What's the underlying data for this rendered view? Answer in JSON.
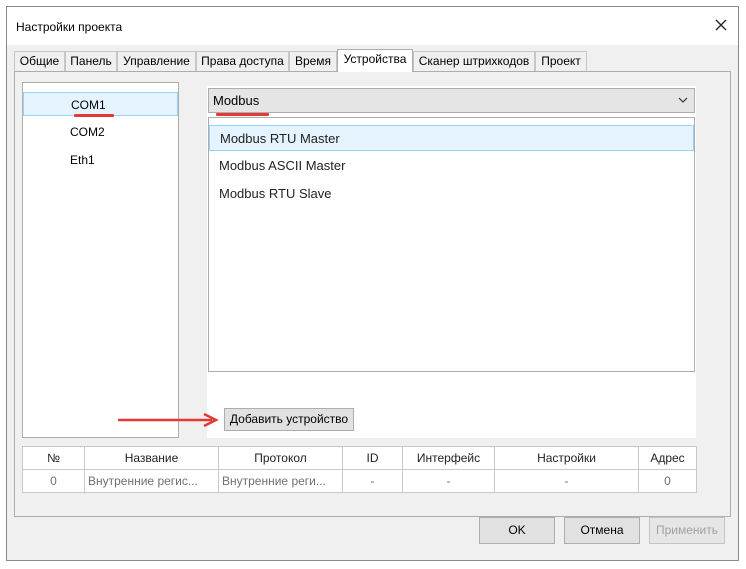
{
  "window": {
    "title": "Настройки проекта",
    "close_icon": "close-icon"
  },
  "tabs": [
    {
      "label": "Общие",
      "active": false
    },
    {
      "label": "Панель",
      "active": false
    },
    {
      "label": "Управление",
      "active": false
    },
    {
      "label": "Права доступа",
      "active": false
    },
    {
      "label": "Время",
      "active": false
    },
    {
      "label": "Устройства",
      "active": true
    },
    {
      "label": "Сканер штрихкодов",
      "active": false
    },
    {
      "label": "Проект",
      "active": false
    }
  ],
  "ports": {
    "items": [
      {
        "label": "COM1",
        "selected": true
      },
      {
        "label": "COM2",
        "selected": false
      },
      {
        "label": "Eth1",
        "selected": false
      }
    ]
  },
  "protocol": {
    "selected": "Modbus",
    "options": [
      {
        "label": "Modbus RTU Master",
        "selected": true
      },
      {
        "label": "Modbus ASCII Master",
        "selected": false
      },
      {
        "label": "Modbus RTU Slave",
        "selected": false
      }
    ]
  },
  "add_device_label": "Добавить устройство",
  "devices_table": {
    "headers": [
      "№",
      "Название",
      "Протокол",
      "ID",
      "Интерфейс",
      "Настройки",
      "Адрес"
    ],
    "rows": [
      [
        "0",
        "Внутренние регис...",
        "Внутренние реги...",
        "-",
        "-",
        "-",
        "0"
      ]
    ]
  },
  "buttons": {
    "ok": "OK",
    "cancel": "Отмена",
    "apply": "Применить"
  },
  "colors": {
    "selection_bg": "#e5f3ff",
    "selection_border": "#99d1ff",
    "annotation_red": "#e53935"
  }
}
